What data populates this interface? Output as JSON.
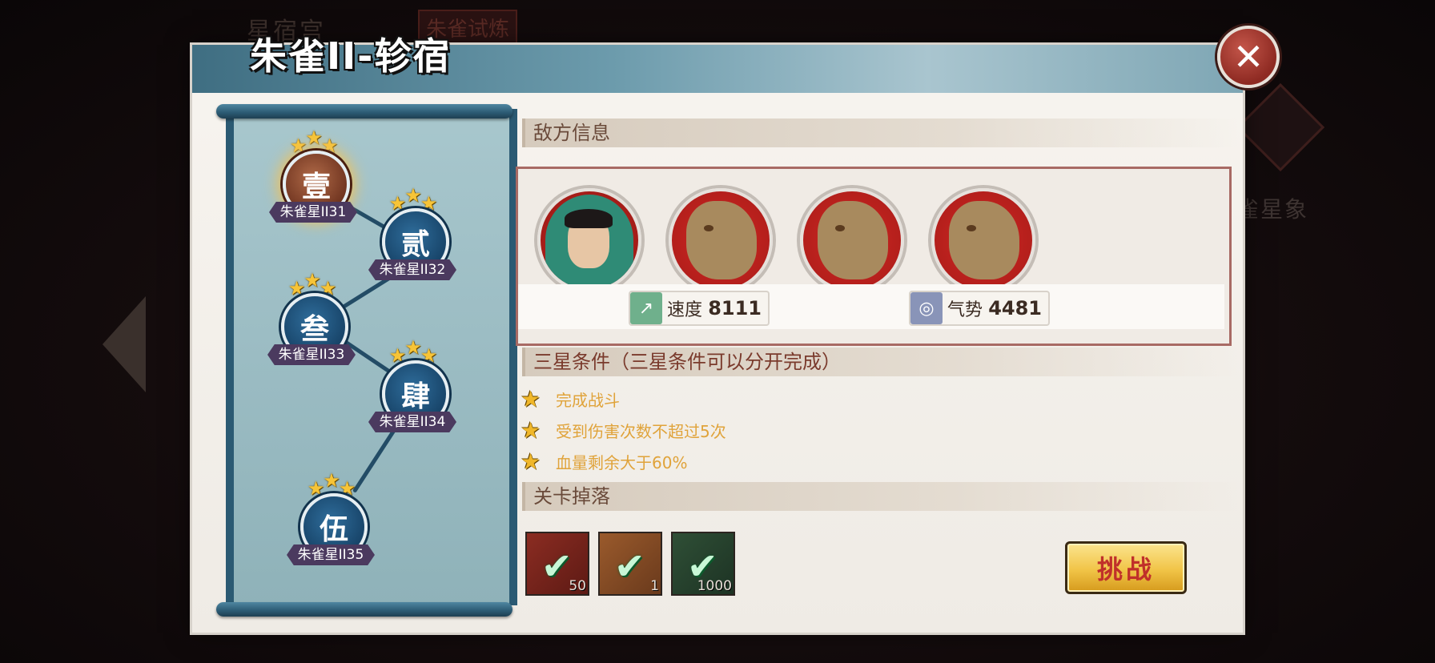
{
  "background": {
    "title": "星宿宫",
    "tag": "朱雀试炼",
    "right_label": "雀星象"
  },
  "dialog": {
    "title": "朱雀II-轸宿",
    "close_label": "✕"
  },
  "stages": [
    {
      "glyph": "壹",
      "label": "朱雀星II31",
      "stars": 3,
      "active": true
    },
    {
      "glyph": "贰",
      "label": "朱雀星II32",
      "stars": 3,
      "active": false
    },
    {
      "glyph": "叁",
      "label": "朱雀星II33",
      "stars": 3,
      "active": false
    },
    {
      "glyph": "肆",
      "label": "朱雀星II34",
      "stars": 3,
      "active": false
    },
    {
      "glyph": "伍",
      "label": "朱雀星II35",
      "stars": 3,
      "active": false
    }
  ],
  "enemy_section": {
    "title": "敌方信息",
    "enemies": [
      "hooded-hero-portrait",
      "wolf-portrait",
      "wolf-portrait",
      "wolf-portrait"
    ],
    "stats": [
      {
        "label": "速度",
        "value": "8111",
        "icon": "speed-icon"
      },
      {
        "label": "气势",
        "value": "4481",
        "icon": "momentum-icon"
      }
    ]
  },
  "conditions_section": {
    "title": "三星条件（三星条件可以分开完成）",
    "items": [
      "完成战斗",
      "受到伤害次数不超过5次",
      "血量剩余大于60%"
    ]
  },
  "drops_section": {
    "title": "关卡掉落",
    "items": [
      {
        "icon": "scroll-item-icon",
        "count": "50",
        "claimed": true
      },
      {
        "icon": "chest-item-icon",
        "count": "1",
        "claimed": true
      },
      {
        "icon": "coin-item-icon",
        "count": "1000",
        "claimed": true
      }
    ]
  },
  "challenge_button": "挑战",
  "colors": {
    "header_blue": "#3f6e82",
    "scroll_frame": "#2b5a73",
    "star_gold": "#f7c437",
    "condition_text": "#e0a33a",
    "challenge_text": "#c0302a"
  }
}
